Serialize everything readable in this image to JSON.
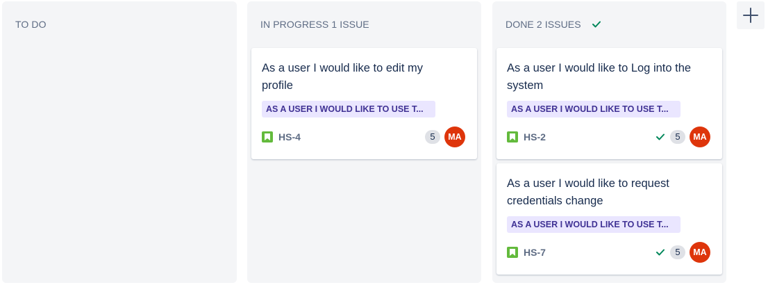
{
  "columns": [
    {
      "id": "todo",
      "title": "TO DO",
      "cards": []
    },
    {
      "id": "in-progress",
      "title": "IN PROGRESS 1 ISSUE",
      "cards": [
        {
          "summary": "As a user I would like to edit my profile",
          "epic": "AS A USER I WOULD LIKE TO USE T...",
          "key": "HS-4",
          "points": "5",
          "assignee_initials": "MA",
          "done": false
        }
      ]
    },
    {
      "id": "done",
      "title": "DONE 2 ISSUES",
      "show_check": true,
      "cards": [
        {
          "summary": "As a user I would like to Log into the system",
          "epic": "AS A USER I WOULD LIKE TO USE T...",
          "key": "HS-2",
          "points": "5",
          "assignee_initials": "MA",
          "done": true
        },
        {
          "summary": "As a user I would like to request credentials change",
          "epic": "AS A USER I WOULD LIKE TO USE T...",
          "key": "HS-7",
          "points": "5",
          "assignee_initials": "MA",
          "done": true
        }
      ]
    }
  ],
  "icons": {
    "add_column": "plus-icon",
    "story": "story-bookmark-icon",
    "done": "check-icon"
  },
  "colors": {
    "column_bg": "#f4f5f7",
    "header_text": "#5e6c84",
    "epic_bg": "#eae6ff",
    "epic_text": "#403294",
    "story_green": "#63ba3c",
    "done_check": "#00875a",
    "avatar_bg": "#de350b",
    "points_bg": "#dfe1e6"
  }
}
